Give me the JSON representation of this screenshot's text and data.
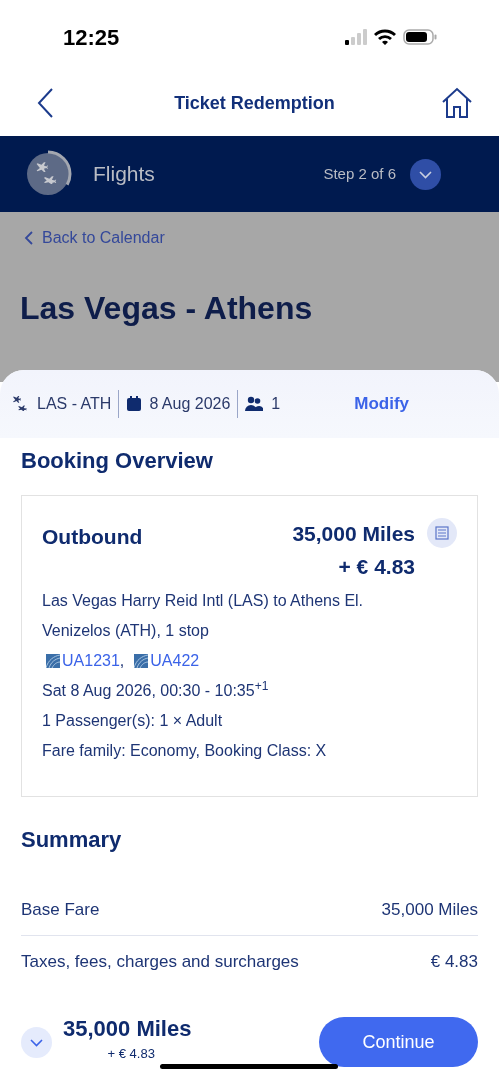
{
  "status_bar": {
    "time": "12:25"
  },
  "nav": {
    "title": "Ticket Redemption"
  },
  "progress": {
    "title": "Flights",
    "step": "Step 2 of 6"
  },
  "back_link": "Back to Calendar",
  "page_title": "Las Vegas - Athens",
  "search_summary": {
    "route": "LAS - ATH",
    "date": "8 Aug 2026",
    "passengers": "1",
    "action": "Modify"
  },
  "booking_overview": {
    "heading": "Booking Overview",
    "outbound": {
      "label": "Outbound",
      "miles": "35,000 Miles",
      "price": "+ € 4.83",
      "details": [
        "Las Vegas Harry Reid Intl (LAS) to Athens El. Venizelos (ATH), 1 stop"
      ],
      "flights": [
        {
          "code": "UA1231",
          "separator": ","
        },
        {
          "code": "UA422"
        }
      ],
      "lines": [
        "Sat 8 Aug 2026, 00:30 - 10:35$^{+1}$",
        "1 Passenger(s): 1 × Adult",
        "Fare family: Economy, Booking Class: X"
      ]
    }
  },
  "summary": {
    "heading": "Summary",
    "rows": [
      {
        "label": "Base Fare",
        "value": "35,000 Miles"
      },
      {
        "label": "Taxes, fees, charges and surcharges",
        "value": "€ 4.83"
      }
    ]
  },
  "footer": {
    "miles": "35,000 Miles",
    "price": "+ € 4.83",
    "button": "Continue"
  }
}
